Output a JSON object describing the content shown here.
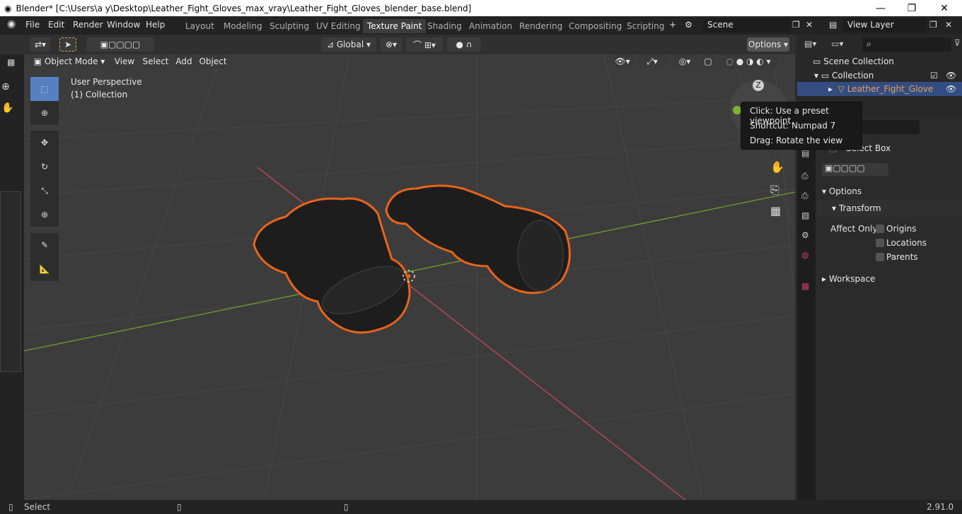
{
  "window": {
    "title": "Blender* [C:\\Users\\a y\\Desktop\\Leather_Fight_Gloves_max_vray\\Leather_Fight_Gloves_blender_base.blend]",
    "minimize": "—",
    "maximize": "❐",
    "close": "✕"
  },
  "menu": [
    "File",
    "Edit",
    "Render",
    "Window",
    "Help"
  ],
  "workspaces": [
    "Layout",
    "Modeling",
    "Sculpting",
    "UV Editing",
    "Texture Paint",
    "Shading",
    "Animation",
    "Rendering",
    "Compositing",
    "Scripting"
  ],
  "active_workspace": "Texture Paint",
  "add_workspace": "+",
  "scene": "Scene",
  "view_layer": "View Layer",
  "header": {
    "transform_orientation": "Global",
    "options": "Options"
  },
  "viewport_header": {
    "mode": "Object Mode",
    "view": "View",
    "select": "Select",
    "add": "Add",
    "object": "Object"
  },
  "viewport": {
    "perspective": "User Perspective",
    "collection": "(1) Collection",
    "gizmo_axis": "Z"
  },
  "tooltip": {
    "line1": "Click: Use a preset viewpoint",
    "line2": "Shortcut: Numpad 7",
    "line3": "Drag: Rotate the view"
  },
  "outliner": {
    "scene_collection": "Scene Collection",
    "collection": "Collection",
    "object": "Leather_Fight_Glove"
  },
  "props": {
    "tool": "Select Box",
    "options": "Options",
    "transform": "Transform",
    "affect_only": "Affect Only",
    "origins": "Origins",
    "locations": "Locations",
    "parents": "Parents",
    "workspace": "Workspace"
  },
  "status": {
    "select": "Select",
    "version": "2.91.0"
  },
  "colors": {
    "accent": "#5680c2",
    "selection_outline": "#e8641b",
    "active_object_text": "#e8a05a",
    "x_axis": "#b94a53",
    "y_axis": "#6f9a2a"
  }
}
